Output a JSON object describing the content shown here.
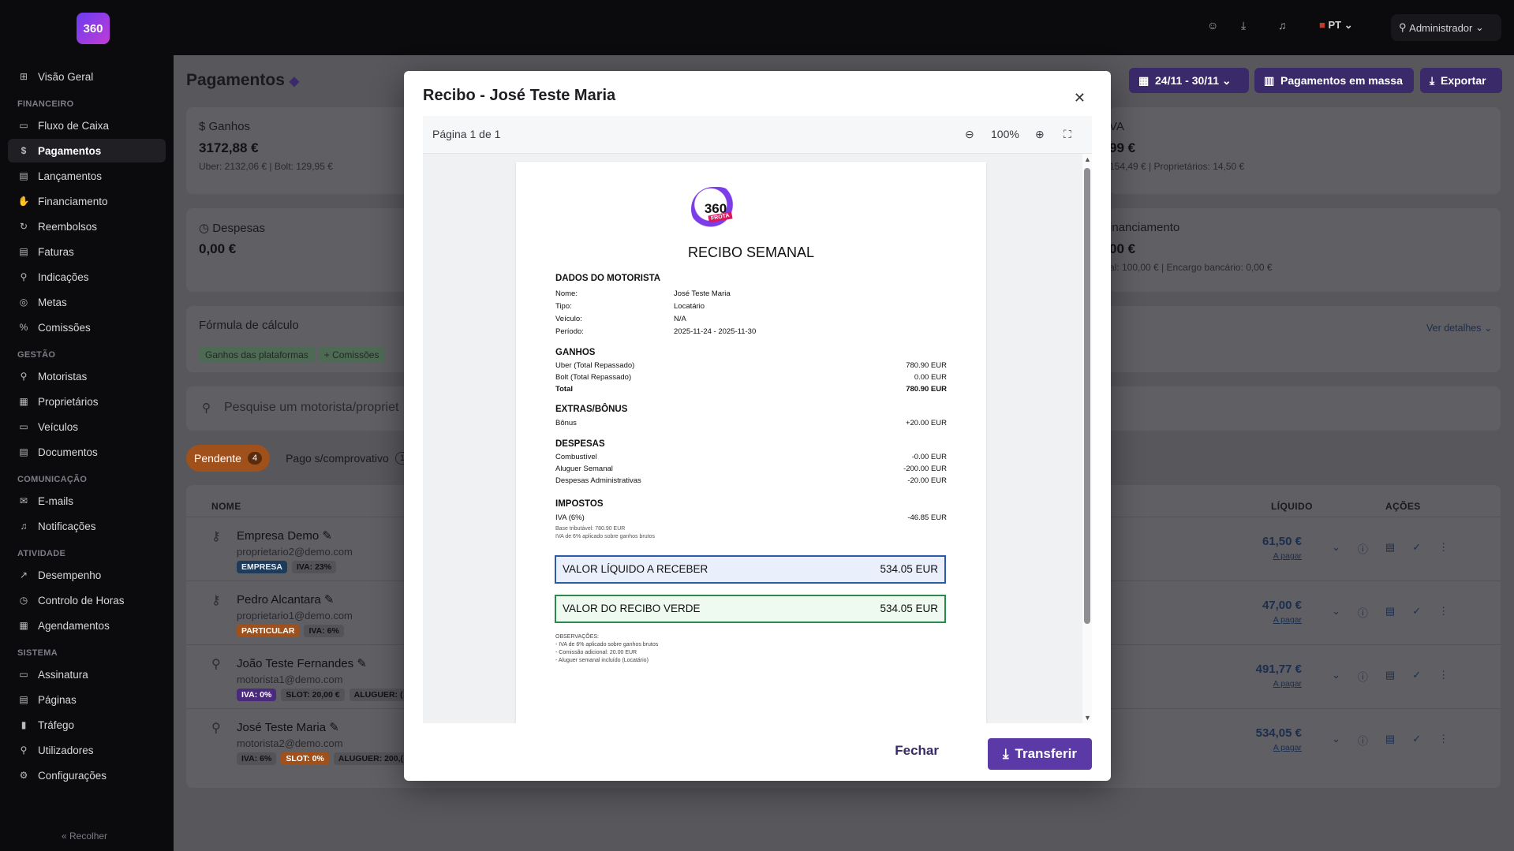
{
  "app": {
    "logo_text": "360"
  },
  "sidebar": {
    "top_item": "Visão Geral",
    "sections": [
      {
        "label": "FINANCEIRO",
        "items": [
          "Fluxo de Caixa",
          "Pagamentos",
          "Lançamentos",
          "Financiamento",
          "Reembolsos",
          "Faturas",
          "Indicações",
          "Metas",
          "Comissões"
        ]
      },
      {
        "label": "GESTÃO",
        "items": [
          "Motoristas",
          "Proprietários",
          "Veículos",
          "Documentos"
        ]
      },
      {
        "label": "COMUNICAÇÃO",
        "items": [
          "E-mails",
          "Notificações"
        ]
      },
      {
        "label": "ATIVIDADE",
        "items": [
          "Desempenho",
          "Controlo de Horas",
          "Agendamentos"
        ]
      },
      {
        "label": "SISTEMA",
        "items": [
          "Assinatura",
          "Páginas",
          "Tráfego",
          "Utilizadores",
          "Configurações"
        ]
      }
    ],
    "active_item": "Pagamentos",
    "collapse_label": "Recolher"
  },
  "topbar": {
    "language": "PT",
    "user": "Administrador"
  },
  "page": {
    "title": "Pagamentos",
    "date_range": "24/11 - 30/11",
    "bulk_button": "Pagamentos em massa",
    "export_button": "Exportar"
  },
  "cards": {
    "ganhos": {
      "title": "Ganhos",
      "value": "3172,88 €",
      "sub": "Uber: 2132,06 € | Bolt: 129,95 €"
    },
    "iva": {
      "title": "VA",
      "value": "99 €",
      "sub": "154,49 € | Proprietários: 14,50 €"
    },
    "despesas": {
      "title": "Despesas",
      "value": "0,00 €"
    },
    "financiamento": {
      "title": "inanciamento",
      "value": "00 €",
      "sub": "al: 100,00 € | Encargo bancário: 0,00 €"
    }
  },
  "formula": {
    "title": "Fórmula de cálculo",
    "chips": [
      "Ganhos das plataformas",
      "+ Comissões"
    ],
    "details_link": "Ver detalhes"
  },
  "search": {
    "placeholder": "Pesquise um motorista/propriet"
  },
  "tabs": [
    {
      "label": "Pendente",
      "count": "4"
    },
    {
      "label": "Pago s/comprovativo",
      "count": "1"
    }
  ],
  "table": {
    "headers": {
      "name": "NOME",
      "net": "LÍQUIDO",
      "actions": "AÇÕES"
    },
    "rows": [
      {
        "name": "Empresa Demo",
        "email": "proprietario2@demo.com",
        "tags": [
          "EMPRESA",
          "IVA: 23%"
        ],
        "amount": "61,50 €",
        "status": "A pagar"
      },
      {
        "name": "Pedro Alcantara",
        "email": "proprietario1@demo.com",
        "tags": [
          "PARTICULAR",
          "IVA: 6%"
        ],
        "amount": "47,00 €",
        "status": "A pagar"
      },
      {
        "name": "João Teste Fernandes",
        "email": "motorista1@demo.com",
        "tags": [
          "IVA: 0%",
          "SLOT: 20,00 €",
          "ALUGUER: ("
        ],
        "amount": "491,77 €",
        "status": "A pagar"
      },
      {
        "name": "José Teste Maria",
        "email": "motorista2@demo.com",
        "tags": [
          "IVA: 6%",
          "SLOT: 0%",
          "ALUGUER: 200,("
        ],
        "amount": "534,05 €",
        "status": "A pagar"
      }
    ]
  },
  "modal": {
    "title": "Recibo - José Teste Maria",
    "page_indicator": "Página 1 de 1",
    "zoom": "100%",
    "close_button": "Fechar",
    "download_button": "Transferir",
    "receipt": {
      "logo_text": "360",
      "logo_stamp": "FROTA",
      "title": "RECIBO SEMANAL",
      "driver_section": "DADOS DO MOTORISTA",
      "driver": [
        {
          "label": "Nome:",
          "value": "José Teste Maria"
        },
        {
          "label": "Tipo:",
          "value": "Locatário"
        },
        {
          "label": "Veículo:",
          "value": "N/A"
        },
        {
          "label": "Período:",
          "value": "2025-11-24 - 2025-11-30"
        }
      ],
      "earnings_section": "GANHOS",
      "earnings": [
        {
          "label": "Uber (Total Repassado)",
          "value": "780.90 EUR"
        },
        {
          "label": "Bolt (Total Repassado)",
          "value": "0.00 EUR"
        },
        {
          "label": "Total",
          "value": "780.90 EUR"
        }
      ],
      "extras_section": "EXTRAS/BÔNUS",
      "extras": [
        {
          "label": "Bônus",
          "value": "+20.00 EUR"
        }
      ],
      "expenses_section": "DESPESAS",
      "expenses": [
        {
          "label": "Combustível",
          "value": "-0.00 EUR"
        },
        {
          "label": "Aluguer Semanal",
          "value": "-200.00 EUR"
        },
        {
          "label": "Despesas Administrativas",
          "value": "-20.00 EUR"
        }
      ],
      "taxes_section": "IMPOSTOS",
      "taxes": [
        {
          "label": "IVA (6%)",
          "value": "-46.85 EUR"
        }
      ],
      "tax_note1": "Base tributável: 780.90 EUR",
      "tax_note2": "IVA de 6% aplicado sobre ganhos brutos",
      "net_label": "VALOR LÍQUIDO A RECEBER",
      "net_value": "534.05 EUR",
      "green_label": "VALOR DO RECIBO VERDE",
      "green_value": "534.05 EUR",
      "obs_title": "OBSERVAÇÕES:",
      "obs": [
        "- IVA de 6% aplicado sobre ganhos brutos",
        "- Comissão adicional: 20.00 EUR",
        "- Aluguer semanal incluído (Locatário)"
      ]
    }
  }
}
